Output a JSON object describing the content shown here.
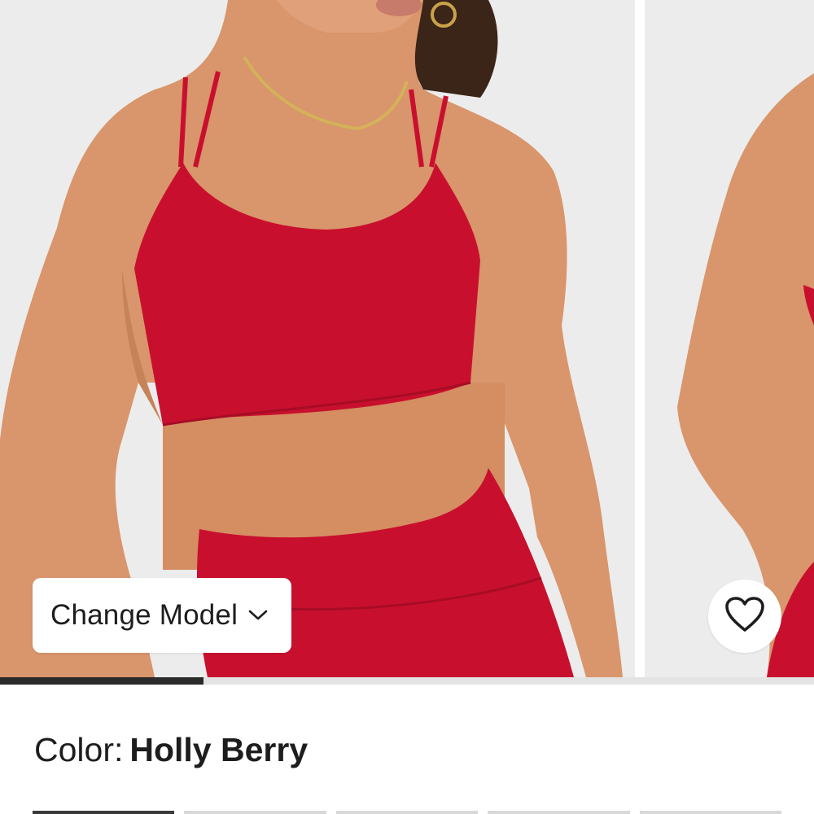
{
  "gallery": {
    "change_model_label": "Change Model",
    "progress_fraction": 0.25,
    "slide_count": 2
  },
  "product": {
    "color_prefix": "Color:",
    "color_value": "Holly Berry",
    "garment_color": "#c8102e"
  },
  "icons": {
    "change_model": "chevron-down-icon",
    "favorite": "heart-outline-icon"
  },
  "colors": {
    "background": "#ececec",
    "text": "#1d1d1d",
    "progress_track": "#e3e3e3",
    "progress_fill": "#2b2b2b"
  }
}
